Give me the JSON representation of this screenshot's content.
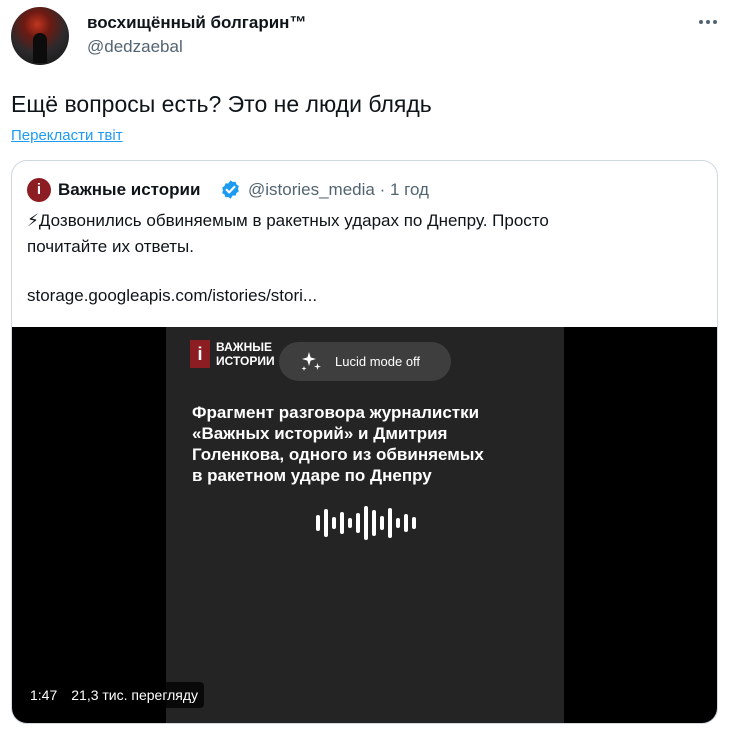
{
  "author": {
    "display_name": "восхищённый болгарин™",
    "handle": "@dedzaebal"
  },
  "tweet": {
    "text": "Ещё вопросы есть? Это не люди блядь",
    "translate_label": "Перекласти твіт"
  },
  "quoted": {
    "avatar_letter": "i",
    "name": "Важные истории",
    "meta": "@istories_media · 1 год",
    "text_lines": [
      "⚡Дозвонились обвиняемым в ракетных ударах по Днепру. Просто",
      "почитайте их ответы."
    ],
    "link": "storage.googleapis.com/istories/stori..."
  },
  "media": {
    "logo_mark": "i",
    "logo_lines": [
      "ВАЖНЫЕ",
      "ИСТОРИИ"
    ],
    "lucid_label": "Lucid mode off",
    "headline_lines": [
      "Фрагмент разговора журналистки",
      "«Важных историй» и Дмитрия",
      "Голенкова, одного из обвиняемых",
      "в ракетном ударе по Днепру"
    ],
    "duration": "1:47",
    "views": "21,3 тис. перегляду"
  },
  "colors": {
    "accent_link": "#1d9bf0",
    "verified": "#1d9bf0",
    "brand_red": "#8c1d22"
  },
  "icons": [
    "more-icon",
    "verified-icon",
    "sparkle-icon",
    "audio-wave-icon"
  ]
}
